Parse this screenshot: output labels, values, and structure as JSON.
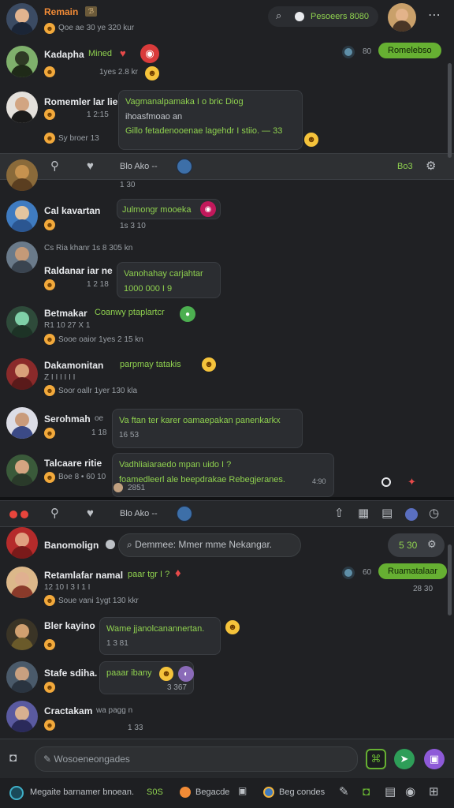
{
  "header": {
    "title": "Remain",
    "badge": "ℬ",
    "subtitle": "Qoe ae 30 ye 320 kur",
    "search_label": "Pesoeers 8080"
  },
  "messages_top": [
    {
      "name": "Kadapha",
      "tag": "Mined",
      "time": "1yes 2.8 kr",
      "action_label": "Romelebso",
      "count": "80"
    },
    {
      "name": "Romemler lar lie",
      "time": "1 2:15",
      "meta": "Sy broer 13",
      "lines": [
        "Vagmanalpamaka I o bric Diog",
        "ihoasfmoao an",
        "Gillo fetadenooenae lagehdr I stiio. — 33"
      ]
    }
  ],
  "toolbar1": {
    "label": "Blo  Ako --",
    "right": "Bo3",
    "sub": "1 30"
  },
  "messages_mid": [
    {
      "name": "Cal kavartan",
      "meta": "1s 3 10",
      "bubble": "Julmongr mooeka"
    },
    {
      "name": "Raldanar iar ne",
      "pre": "Cs Ria khanr 1s 8 305 kn",
      "time": "1 2 18",
      "lines": [
        "Vanohahay carjahtar",
        "1000 000 I 9"
      ]
    },
    {
      "name": "Betmakar",
      "tag": "Coanwy ptaplartcr",
      "meta": "R1 10 27 X 1",
      "meta2": "Sooe oaior 1yes 2 15 kn"
    },
    {
      "name": "Dakamonitan",
      "tag": "parpmay tatakis",
      "meta": "Z I I I I I I",
      "meta2": "Soor oallr 1yer 130 kla"
    },
    {
      "name": "Serohmah",
      "tag": "oe",
      "time": "1 18",
      "bubble": "Va ftan ter karer oamaepakan panenkarkx",
      "bubble_time": "16 53"
    },
    {
      "name": "Talcaare ritie",
      "meta": "Boe 8 • 60 10",
      "lines": [
        "Vadhliaiaraedo mpan uido I ?",
        "foamedleerl ale beepdrakae Rebegjeranes."
      ],
      "time2": "2851",
      "ext": "4:90"
    }
  ],
  "toolbar2": {
    "label": "Blo  Ako --"
  },
  "section2": {
    "name": "Banomolign",
    "search": "Demmee: Mmer mme Nekangar.",
    "count": "5 30"
  },
  "messages_bottom": [
    {
      "name": "Retamlafar namal",
      "tag": "paar tgr I ?",
      "meta": "12 10 I 3 I 1 I",
      "meta2": "Soue vani 1ygt 130 kkr",
      "action_label": "Ruamatalaar",
      "count": "60",
      "time": "28 30"
    },
    {
      "name": "Bler kayino",
      "bubble": "Wame jjanolcanannertan.",
      "time": "1 3 81"
    },
    {
      "name": "Stafe sdiha.",
      "bubble": "paaar ibany",
      "time": "3 367"
    },
    {
      "name": "Cractakam",
      "meta": "wa pagg n",
      "time": "1 33"
    }
  ],
  "composer": {
    "placeholder": "Wosoeneongades"
  },
  "footer": {
    "left": "Megaite barnamer bnoean.",
    "count": "S0S",
    "mid": "Begacde",
    "right": "Beg condes"
  },
  "colors": {
    "accent_green": "#66b032",
    "text_green": "#8fd14f",
    "background": "#202124"
  }
}
